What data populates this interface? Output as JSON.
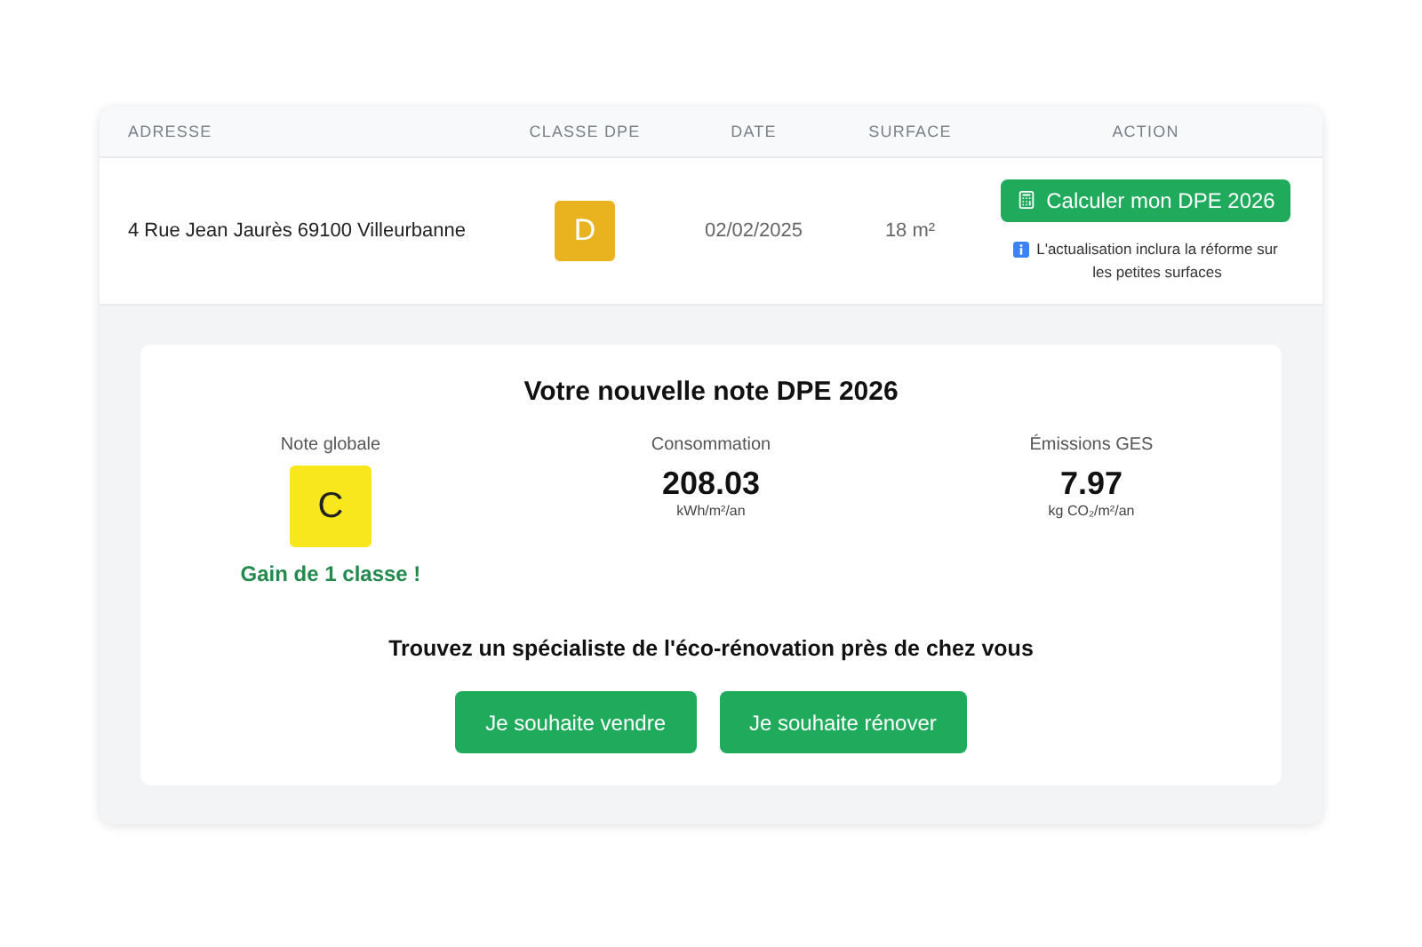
{
  "table": {
    "columns": [
      "ADRESSE",
      "CLASSE DPE",
      "DATE",
      "SURFACE",
      "ACTION"
    ],
    "rows": [
      {
        "address": "4 Rue Jean Jaurès 69100 Villeurbanne",
        "dpe_class": {
          "label": "D",
          "color": "#e9b320"
        },
        "date": "02/02/2025",
        "surface": "18 m²",
        "action_button": "Calculer mon DPE 2026",
        "note": "L'actualisation inclura la réforme sur les petites surfaces"
      }
    ]
  },
  "result": {
    "title": "Votre nouvelle note DPE 2026",
    "global": {
      "label": "Note globale",
      "grade": "C",
      "color": "#f8e71c",
      "gain": "Gain de 1 classe !"
    },
    "metrics": [
      {
        "label": "Consommation",
        "value": "208.03",
        "unit": "kWh/m²/an"
      },
      {
        "label": "Émissions GES",
        "value": "7.97",
        "unit": "kg CO₂/m²/an"
      }
    ],
    "cta_title": "Trouvez un spécialiste de l'éco-rénovation près de chez vous",
    "buttons": [
      "Je souhaite vendre",
      "Je souhaite rénover"
    ]
  }
}
